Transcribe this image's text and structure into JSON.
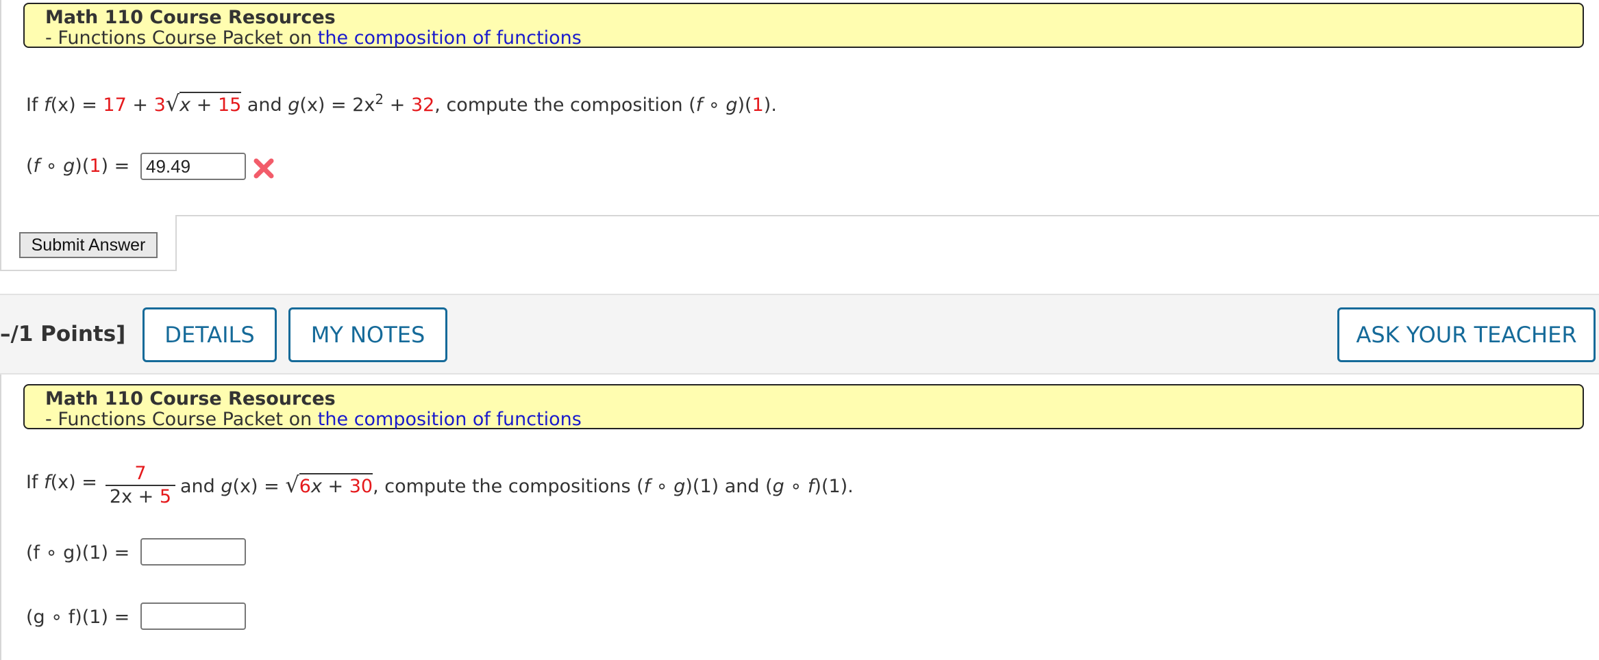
{
  "problem1": {
    "resources": {
      "title": "Math 110 Course Resources",
      "prefix": "- Functions Course Packet on ",
      "link": "the composition of functions"
    },
    "question": {
      "if": "If ",
      "f": "f",
      "x_eq": "(x) = ",
      "c1": "17",
      "plus1": " + ",
      "c2": "3",
      "rad_x": "x + ",
      "rad_c": "15",
      "and": " and ",
      "g": "g",
      "gx_eq": "(x) = 2x",
      "exp": "2",
      "plus2": " + ",
      "c3": "32",
      "tail": ", compute the composition (",
      "f2": "f",
      "circ": " ∘ ",
      "g2": "g",
      "paren": ")(",
      "arg": "1",
      "end": ")."
    },
    "answer_label": {
      "open": "(",
      "f": "f",
      "circ": " ∘ ",
      "g": "g",
      "mid": ")(",
      "arg": "1",
      "close": ") ="
    },
    "answer_value": "49.49",
    "status_icon": "incorrect-x-icon",
    "submit_label": "Submit Answer"
  },
  "problem2_header": {
    "points": "–/1 Points]",
    "details": "DETAILS",
    "my_notes": "MY NOTES",
    "ask_teacher": "ASK YOUR TEACHER"
  },
  "problem2": {
    "resources": {
      "title": "Math 110 Course Resources",
      "prefix": "- Functions Course Packet on ",
      "link": "the composition of functions"
    },
    "question": {
      "if": "If ",
      "f": "f",
      "x_eq": "(x) =",
      "num": "7",
      "den_x": "2x + ",
      "den_c": "5",
      "and": "and ",
      "g": "g",
      "gx_eq": "(x) = ",
      "rad_c": "6",
      "rad_x": "x + ",
      "rad_c2": "30",
      "tail": ", compute the compositions (",
      "f2": "f",
      "circ1": " ∘ ",
      "g2": "g",
      "mid1": ")(1) and (",
      "g3": "g",
      "circ2": " ∘ ",
      "f3": "f",
      "end": ")(1)."
    },
    "answer1_label": "(f ∘ g)(1) =",
    "answer2_label": "(g ∘ f)(1) =",
    "answer1_value": "",
    "answer2_value": ""
  },
  "colors": {
    "highlight_bg": "#fffdb0",
    "link": "#1a1acc",
    "constant_red": "#e5191c",
    "button_blue": "#156a99",
    "error_x": "#f25c6a"
  }
}
